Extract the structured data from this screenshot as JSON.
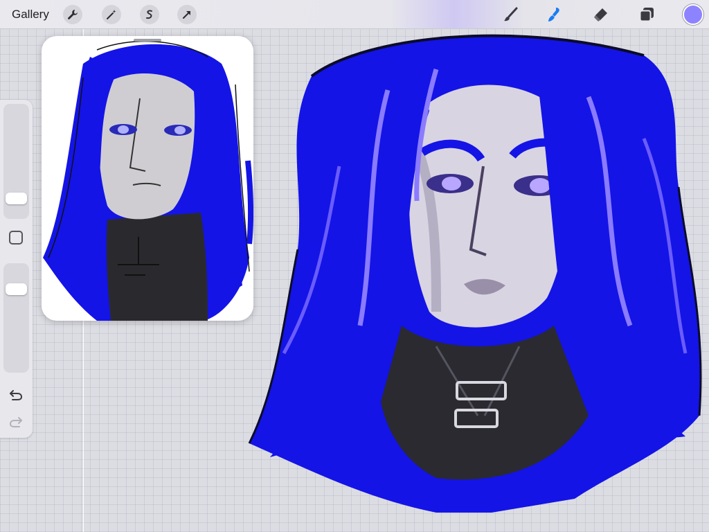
{
  "toolbar": {
    "gallery_label": "Gallery",
    "left_tools": [
      "wrench-icon",
      "magic-wand-icon",
      "selection-icon",
      "transform-arrow-icon"
    ],
    "right_tools": [
      "brush-icon",
      "smudge-icon",
      "eraser-icon",
      "layers-icon"
    ],
    "active_tool": "smudge-icon",
    "active_color": "#8e83ff"
  },
  "sidebar": {
    "tools": [
      "brush-size-slider",
      "modify-button",
      "opacity-slider",
      "undo-icon",
      "redo-icon"
    ]
  },
  "reference": {
    "content": "reference-image-of-blue-haired-character"
  },
  "canvas": {
    "content": "painting-of-blue-haired-character-with-purple-eyes",
    "colors": {
      "hair": "#1414e6",
      "highlight": "#8a7bff",
      "skin": "#d9d4e2",
      "collar": "#2a2a30",
      "canvas_bg": "#dcdde3"
    }
  }
}
